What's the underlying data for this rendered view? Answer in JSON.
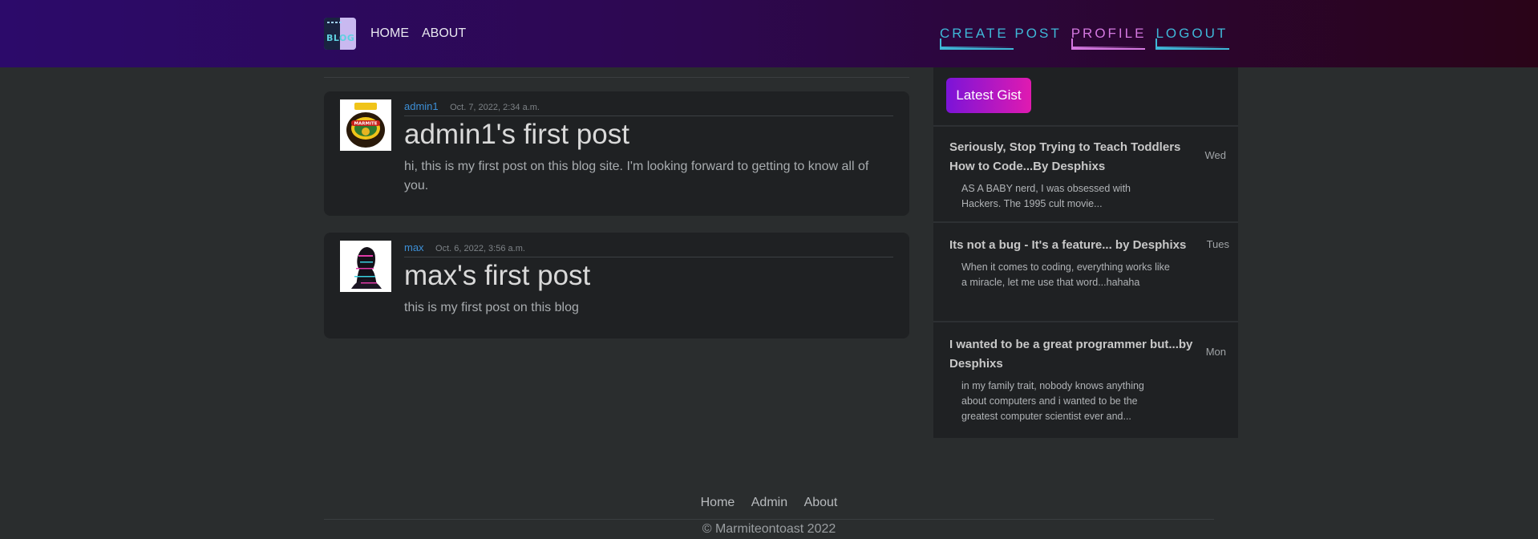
{
  "navbar": {
    "logo_text": "BLOG",
    "left_links": [
      "HOME",
      "ABOUT"
    ],
    "right_links": [
      "CREATE POST",
      "PROFILE",
      "LOGOUT"
    ]
  },
  "posts": [
    {
      "author": "admin1",
      "date": "Oct. 7, 2022, 2:34 a.m.",
      "title": "admin1's first post",
      "body": "hi, this is my first post on this blog site. I'm looking forward to getting to know all of you."
    },
    {
      "author": "max",
      "date": "Oct. 6, 2022, 3:56 a.m.",
      "title": "max's first post",
      "body": "this is my first post on this blog"
    }
  ],
  "sidebar": {
    "button_label": "Latest Gist",
    "gists": [
      {
        "title": "Seriously, Stop Trying to Teach Toddlers How to Code...By Desphixs",
        "day": "Wed",
        "desc": "AS A BABY nerd, I was obsessed with Hackers. The 1995 cult movie..."
      },
      {
        "title": "Its not a bug - It's a feature... by Desphixs",
        "day": "Tues",
        "desc": "When it comes to coding, everything works like a miracle, let me use that word...hahaha"
      },
      {
        "title": "I wanted to be a great programmer but...by Desphixs",
        "day": "Mon",
        "desc": "in my family trait, nobody knows anything about computers and i wanted to be the greatest computer scientist ever and..."
      }
    ]
  },
  "footer": {
    "links": [
      "Home",
      "Admin",
      "About"
    ],
    "copyright": "© Marmiteontoast 2022"
  },
  "colors": {
    "accent_cyan": "#3fb8d8",
    "accent_pink": "#d478e0",
    "author_link": "#3d8fd6"
  }
}
